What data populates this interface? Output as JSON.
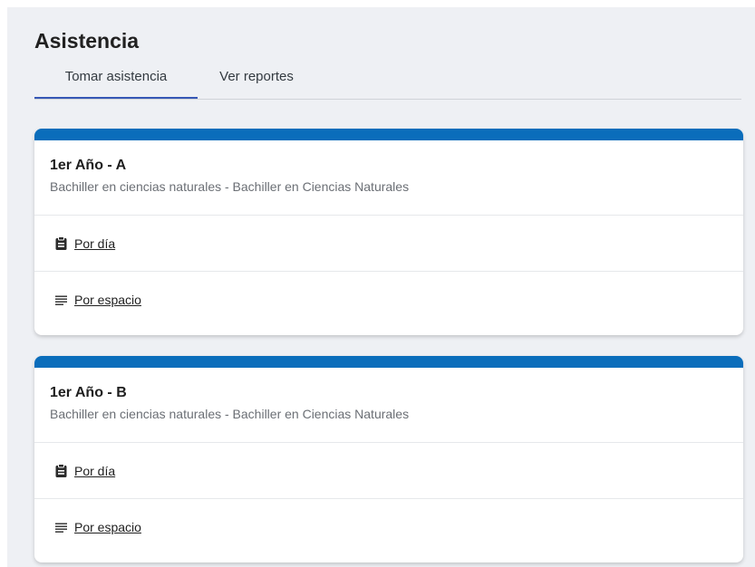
{
  "page": {
    "title": "Asistencia"
  },
  "tabs": [
    {
      "label": "Tomar asistencia",
      "active": true
    },
    {
      "label": "Ver reportes",
      "active": false
    }
  ],
  "colors": {
    "accent_bar": "#0a6dbb",
    "tab_indicator": "#3657b5",
    "background": "#eef0f4"
  },
  "cards": [
    {
      "title": "1er Año - A",
      "subtitle": "Bachiller en ciencias naturales - Bachiller en Ciencias Naturales",
      "links": [
        {
          "label": "Por día",
          "icon": "clipboard-icon"
        },
        {
          "label": "Por espacio",
          "icon": "list-lines-icon"
        }
      ]
    },
    {
      "title": "1er Año - B",
      "subtitle": "Bachiller en ciencias naturales - Bachiller en Ciencias Naturales",
      "links": [
        {
          "label": "Por día",
          "icon": "clipboard-icon"
        },
        {
          "label": "Por espacio",
          "icon": "list-lines-icon"
        }
      ]
    }
  ]
}
